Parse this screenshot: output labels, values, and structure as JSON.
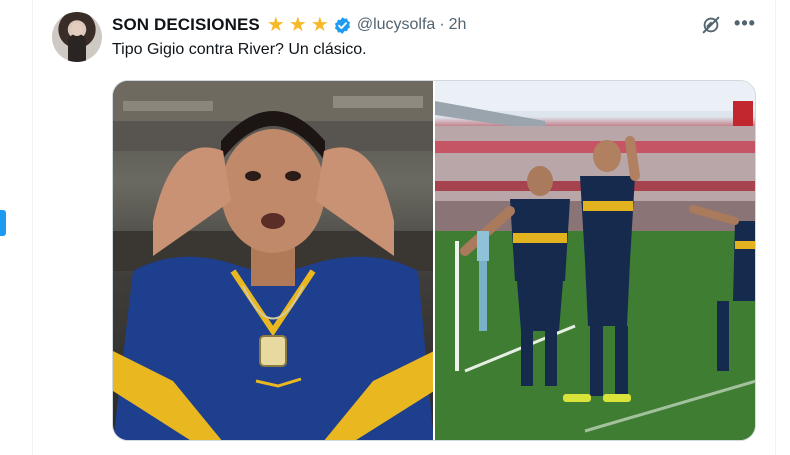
{
  "tweet": {
    "display_name": "SON DECISIONES",
    "handle": "@lucysolfa",
    "separator": "·",
    "time": "2h",
    "star_count": 3,
    "text": "Tipo Gigio contra River? Un clásico."
  },
  "icons": {
    "star": "star-icon",
    "verified": "verified-badge-icon",
    "grok": "grok-icon",
    "more": "more-options-icon"
  },
  "colors": {
    "star": "#f7b928",
    "verified": "#1d9bf0",
    "accent": "#1d9bf0",
    "secondary_text": "#536471"
  },
  "media": {
    "images": [
      {
        "description": "player cupping hands to ears in blue and yellow jersey"
      },
      {
        "description": "two players celebrating on the pitch, stadium crowd behind"
      }
    ]
  }
}
